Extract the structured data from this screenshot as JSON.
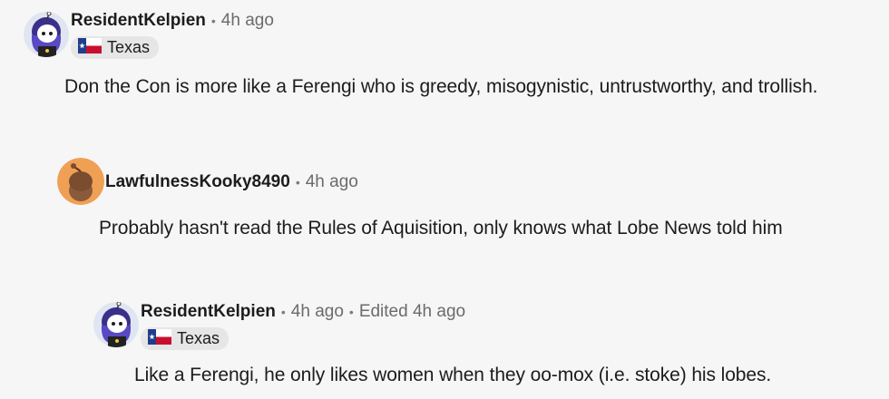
{
  "comments": [
    {
      "username": "ResidentKelpien",
      "timestamp": "4h ago",
      "flair": "Texas",
      "flair_flag_icon": "texas-flag-icon",
      "text": "Don the Con is more like a Ferengi who is greedy, misogynistic, untrustworthy, and trollish."
    },
    {
      "username": "LawfulnessKooky8490",
      "timestamp": "4h ago",
      "text": "Probably hasn't read the Rules of Aquisition, only knows what Lobe News told him"
    },
    {
      "username": "ResidentKelpien",
      "timestamp": "4h ago",
      "edited": "Edited 4h ago",
      "flair": "Texas",
      "flair_flag_icon": "texas-flag-icon",
      "text": "Like a Ferengi, he only likes women when they oo-mox (i.e. stoke) his lobes."
    }
  ],
  "colors": {
    "background": "#f6f6f6",
    "username": "#1c1c1c",
    "meta": "#6b6b6b",
    "flair_bg": "#e6e6e6",
    "avatar_orange": "#f0a055"
  }
}
